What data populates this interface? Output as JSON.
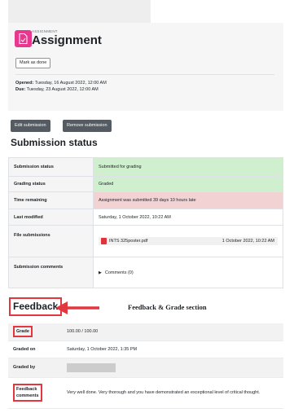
{
  "activity": {
    "type_label": "ASSIGNMENT",
    "title": "Assignment",
    "icon": "assignment-file-icon",
    "mark_done_label": "Mark as done",
    "opened_label": "Opened:",
    "opened_value": "Tuesday, 16 August 2022, 12:00 AM",
    "due_label": "Due:",
    "due_value": "Tuesday, 23 August 2022, 12:00 AM"
  },
  "actions": {
    "edit_label": "Edit submission",
    "remove_label": "Remove submission"
  },
  "submission": {
    "heading": "Submission status",
    "rows": {
      "status_label": "Submission status",
      "status_value": "Submitted for grading",
      "grading_label": "Grading status",
      "grading_value": "Graded",
      "time_label": "Time remaining",
      "time_value": "Assignment was submitted 39 days 10 hours late",
      "modified_label": "Last modified",
      "modified_value": "Saturday, 1 October 2022, 10:22 AM",
      "files_label": "File submissions",
      "file_name": "INTS 325poster.pdf",
      "file_date": "1 October 2022, 10:22 AM",
      "comments_label": "Submission comments",
      "comments_value": "Comments (0)"
    }
  },
  "feedback": {
    "heading": "Feedback",
    "caption": "Feedback & Grade section",
    "grade_label": "Grade",
    "grade_value": "100.00 / 100.00",
    "graded_on_label": "Graded on",
    "graded_on_value": "Saturday, 1 October 2022, 1:35 PM",
    "graded_by_label": "Graded by",
    "comments_label_line1": "Feedback",
    "comments_label_line2": "comments",
    "comments_value": "Very well done. Very thorough and you have demonstrated an exceptional level of critical thought."
  },
  "colors": {
    "assignment_pink": "#e8378f",
    "status_green": "#cfefcf",
    "status_red": "#f3d2d4",
    "annotation_red": "#e2373f",
    "button_dark": "#545b62"
  }
}
